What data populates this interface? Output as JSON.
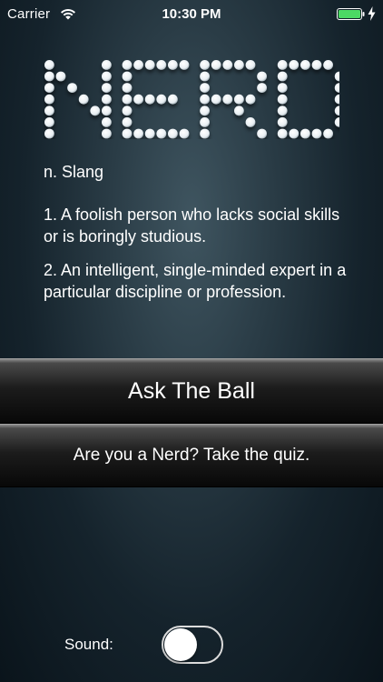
{
  "status_bar": {
    "carrier": "Carrier",
    "time": "10:30 PM",
    "battery_color": "#4cd964"
  },
  "logo": {
    "text": "NERD"
  },
  "definition": {
    "part_of_speech": "n. Slang",
    "meaning_1": "1. A foolish person who lacks social skills or is boringly studious.",
    "meaning_2": "2. An intelligent, single-minded expert in a particular discipline or profession."
  },
  "buttons": {
    "ask_label": "Ask The Ball",
    "quiz_label": "Are you a Nerd? Take the quiz."
  },
  "sound": {
    "label": "Sound:",
    "enabled": false
  }
}
